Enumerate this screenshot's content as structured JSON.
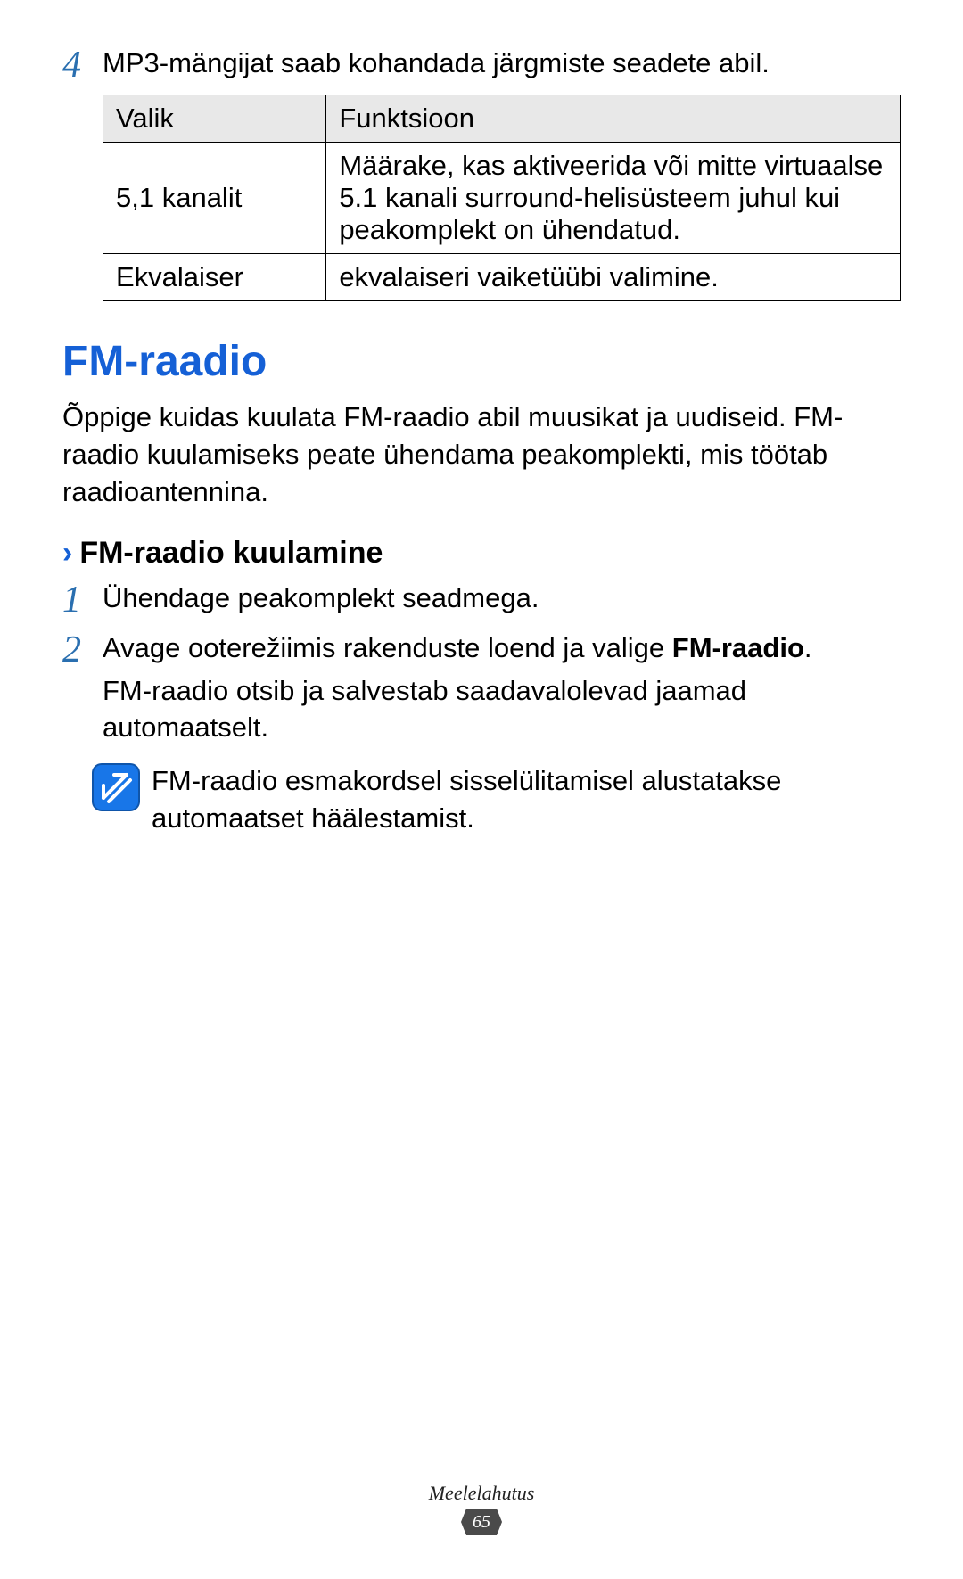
{
  "step4": {
    "num": "4",
    "text": "MP3-mängijat saab kohandada järgmiste seadete abil."
  },
  "table": {
    "head": {
      "c1": "Valik",
      "c2": "Funktsioon"
    },
    "rows": [
      {
        "c1": "5,1 kanalit",
        "c2": "Määrake, kas aktiveerida või mitte virtuaalse 5.1 kanali surround-helisüsteem juhul kui peakomplekt on ühendatud."
      },
      {
        "c1": "Ekvalaiser",
        "c2": "ekvalaiseri vaiketüübi valimine."
      }
    ]
  },
  "section": {
    "title": "FM-raadio",
    "body": "Õppige kuidas kuulata FM-raadio abil muusikat ja uudiseid. FM-raadio kuulamiseks peate ühendama peakomplekti, mis töötab raadioantennina."
  },
  "sub": {
    "chevron": "›",
    "title": "FM-raadio kuulamine",
    "steps": [
      {
        "num": "1",
        "text": "Ühendage peakomplekt seadmega."
      },
      {
        "num": "2",
        "text_a": "Avage ooterežiimis rakenduste loend ja valige ",
        "text_bold": "FM-raadio",
        "text_b": ".",
        "text_sub": "FM-raadio otsib ja salvestab saadavalolevad jaamad automaatselt."
      }
    ],
    "note": "FM-raadio esmakordsel sisselülitamisel alustatakse automaatset häälestamist."
  },
  "footer": {
    "category": "Meelelahutus",
    "page": "65"
  }
}
